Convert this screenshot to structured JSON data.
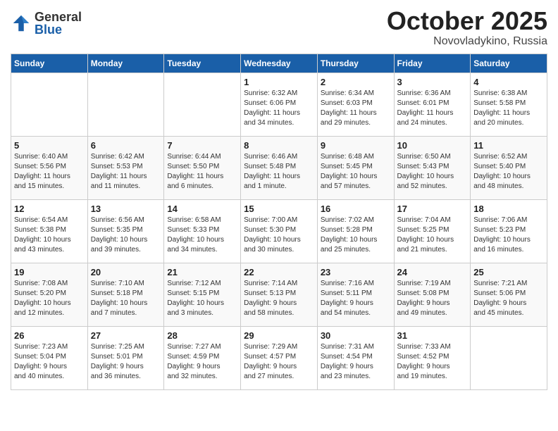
{
  "logo": {
    "general": "General",
    "blue": "Blue"
  },
  "header": {
    "month": "October 2025",
    "location": "Novovladykino, Russia"
  },
  "weekdays": [
    "Sunday",
    "Monday",
    "Tuesday",
    "Wednesday",
    "Thursday",
    "Friday",
    "Saturday"
  ],
  "weeks": [
    [
      {
        "day": "",
        "info": ""
      },
      {
        "day": "",
        "info": ""
      },
      {
        "day": "",
        "info": ""
      },
      {
        "day": "1",
        "info": "Sunrise: 6:32 AM\nSunset: 6:06 PM\nDaylight: 11 hours\nand 34 minutes."
      },
      {
        "day": "2",
        "info": "Sunrise: 6:34 AM\nSunset: 6:03 PM\nDaylight: 11 hours\nand 29 minutes."
      },
      {
        "day": "3",
        "info": "Sunrise: 6:36 AM\nSunset: 6:01 PM\nDaylight: 11 hours\nand 24 minutes."
      },
      {
        "day": "4",
        "info": "Sunrise: 6:38 AM\nSunset: 5:58 PM\nDaylight: 11 hours\nand 20 minutes."
      }
    ],
    [
      {
        "day": "5",
        "info": "Sunrise: 6:40 AM\nSunset: 5:56 PM\nDaylight: 11 hours\nand 15 minutes."
      },
      {
        "day": "6",
        "info": "Sunrise: 6:42 AM\nSunset: 5:53 PM\nDaylight: 11 hours\nand 11 minutes."
      },
      {
        "day": "7",
        "info": "Sunrise: 6:44 AM\nSunset: 5:50 PM\nDaylight: 11 hours\nand 6 minutes."
      },
      {
        "day": "8",
        "info": "Sunrise: 6:46 AM\nSunset: 5:48 PM\nDaylight: 11 hours\nand 1 minute."
      },
      {
        "day": "9",
        "info": "Sunrise: 6:48 AM\nSunset: 5:45 PM\nDaylight: 10 hours\nand 57 minutes."
      },
      {
        "day": "10",
        "info": "Sunrise: 6:50 AM\nSunset: 5:43 PM\nDaylight: 10 hours\nand 52 minutes."
      },
      {
        "day": "11",
        "info": "Sunrise: 6:52 AM\nSunset: 5:40 PM\nDaylight: 10 hours\nand 48 minutes."
      }
    ],
    [
      {
        "day": "12",
        "info": "Sunrise: 6:54 AM\nSunset: 5:38 PM\nDaylight: 10 hours\nand 43 minutes."
      },
      {
        "day": "13",
        "info": "Sunrise: 6:56 AM\nSunset: 5:35 PM\nDaylight: 10 hours\nand 39 minutes."
      },
      {
        "day": "14",
        "info": "Sunrise: 6:58 AM\nSunset: 5:33 PM\nDaylight: 10 hours\nand 34 minutes."
      },
      {
        "day": "15",
        "info": "Sunrise: 7:00 AM\nSunset: 5:30 PM\nDaylight: 10 hours\nand 30 minutes."
      },
      {
        "day": "16",
        "info": "Sunrise: 7:02 AM\nSunset: 5:28 PM\nDaylight: 10 hours\nand 25 minutes."
      },
      {
        "day": "17",
        "info": "Sunrise: 7:04 AM\nSunset: 5:25 PM\nDaylight: 10 hours\nand 21 minutes."
      },
      {
        "day": "18",
        "info": "Sunrise: 7:06 AM\nSunset: 5:23 PM\nDaylight: 10 hours\nand 16 minutes."
      }
    ],
    [
      {
        "day": "19",
        "info": "Sunrise: 7:08 AM\nSunset: 5:20 PM\nDaylight: 10 hours\nand 12 minutes."
      },
      {
        "day": "20",
        "info": "Sunrise: 7:10 AM\nSunset: 5:18 PM\nDaylight: 10 hours\nand 7 minutes."
      },
      {
        "day": "21",
        "info": "Sunrise: 7:12 AM\nSunset: 5:15 PM\nDaylight: 10 hours\nand 3 minutes."
      },
      {
        "day": "22",
        "info": "Sunrise: 7:14 AM\nSunset: 5:13 PM\nDaylight: 9 hours\nand 58 minutes."
      },
      {
        "day": "23",
        "info": "Sunrise: 7:16 AM\nSunset: 5:11 PM\nDaylight: 9 hours\nand 54 minutes."
      },
      {
        "day": "24",
        "info": "Sunrise: 7:19 AM\nSunset: 5:08 PM\nDaylight: 9 hours\nand 49 minutes."
      },
      {
        "day": "25",
        "info": "Sunrise: 7:21 AM\nSunset: 5:06 PM\nDaylight: 9 hours\nand 45 minutes."
      }
    ],
    [
      {
        "day": "26",
        "info": "Sunrise: 7:23 AM\nSunset: 5:04 PM\nDaylight: 9 hours\nand 40 minutes."
      },
      {
        "day": "27",
        "info": "Sunrise: 7:25 AM\nSunset: 5:01 PM\nDaylight: 9 hours\nand 36 minutes."
      },
      {
        "day": "28",
        "info": "Sunrise: 7:27 AM\nSunset: 4:59 PM\nDaylight: 9 hours\nand 32 minutes."
      },
      {
        "day": "29",
        "info": "Sunrise: 7:29 AM\nSunset: 4:57 PM\nDaylight: 9 hours\nand 27 minutes."
      },
      {
        "day": "30",
        "info": "Sunrise: 7:31 AM\nSunset: 4:54 PM\nDaylight: 9 hours\nand 23 minutes."
      },
      {
        "day": "31",
        "info": "Sunrise: 7:33 AM\nSunset: 4:52 PM\nDaylight: 9 hours\nand 19 minutes."
      },
      {
        "day": "",
        "info": ""
      }
    ]
  ]
}
